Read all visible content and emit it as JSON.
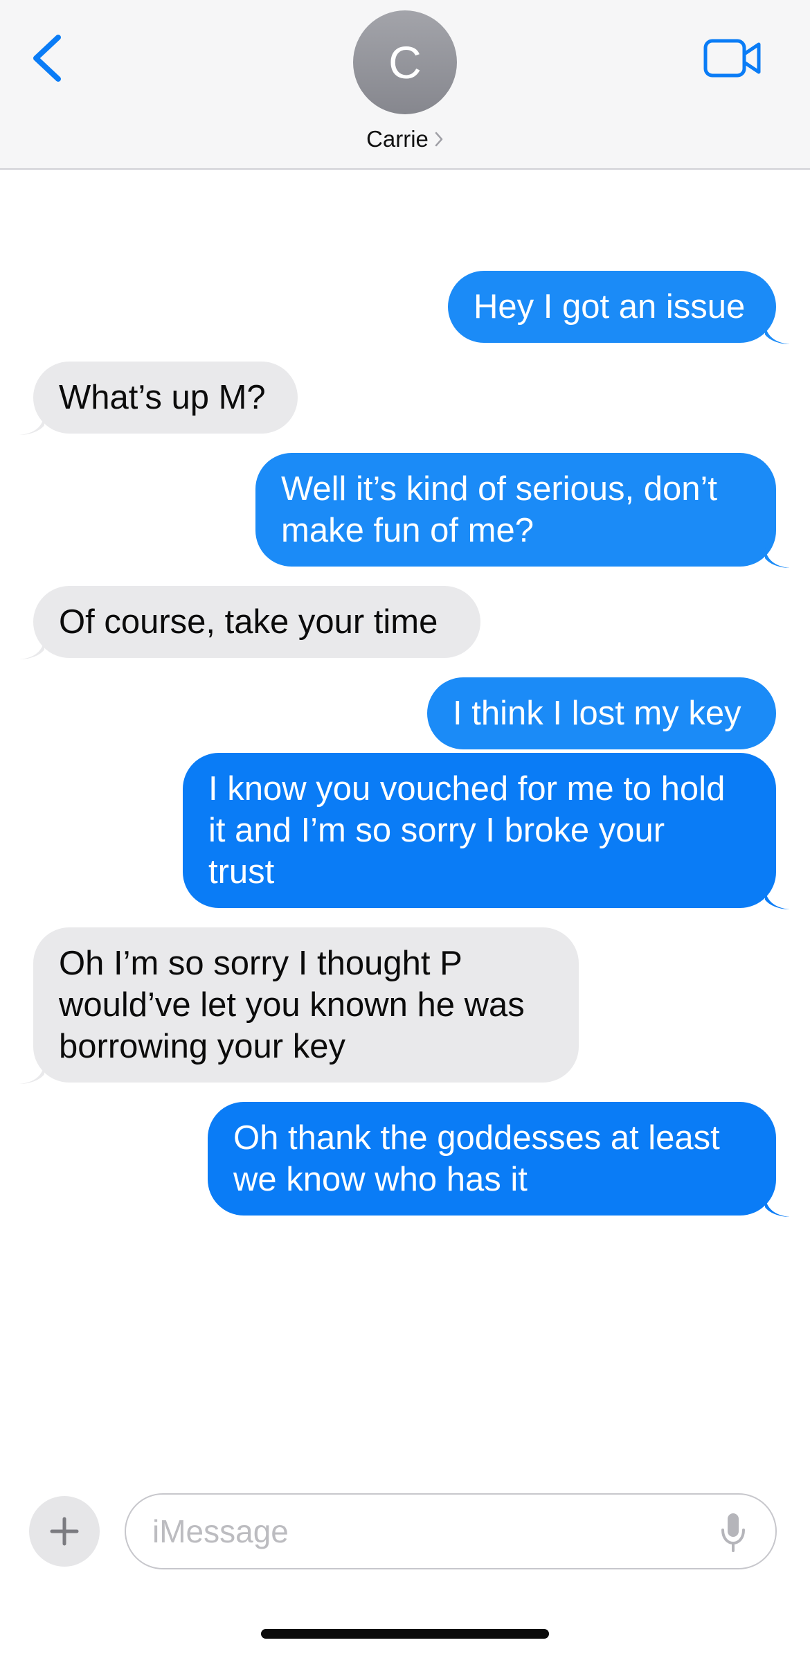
{
  "header": {
    "contact_initial": "C",
    "contact_name": "Carrie"
  },
  "icons": {
    "back": "chevron-left-icon",
    "video": "video-camera-icon",
    "name_chevron": "chevron-right-icon",
    "plus": "plus-icon",
    "mic": "microphone-icon"
  },
  "colors": {
    "sent_bubble": "#1b8bf7",
    "received_bubble": "#e9e9eb",
    "accent": "#0a7cf6"
  },
  "messages": [
    {
      "direction": "sent",
      "lines": [
        "Hey I got an issue"
      ]
    },
    {
      "direction": "received",
      "lines": [
        "What’s up M?"
      ]
    },
    {
      "direction": "sent",
      "lines": [
        "Well it’s kind of serious, don’t",
        "make fun of me?"
      ]
    },
    {
      "direction": "received",
      "lines": [
        "Of course, take your time"
      ]
    },
    {
      "direction": "sent",
      "lines": [
        "I think I lost my key"
      ]
    },
    {
      "direction": "sent",
      "lines": [
        "I know you vouched for me to hold",
        "it and I’m so sorry I broke your",
        "trust"
      ]
    },
    {
      "direction": "received",
      "lines": [
        "Oh I’m so sorry I thought P",
        "would’ve let you known he was",
        "borrowing your key"
      ]
    },
    {
      "direction": "sent",
      "lines": [
        "Oh thank the goddesses at least",
        "we know who has it"
      ]
    }
  ],
  "composer": {
    "placeholder": "iMessage"
  }
}
